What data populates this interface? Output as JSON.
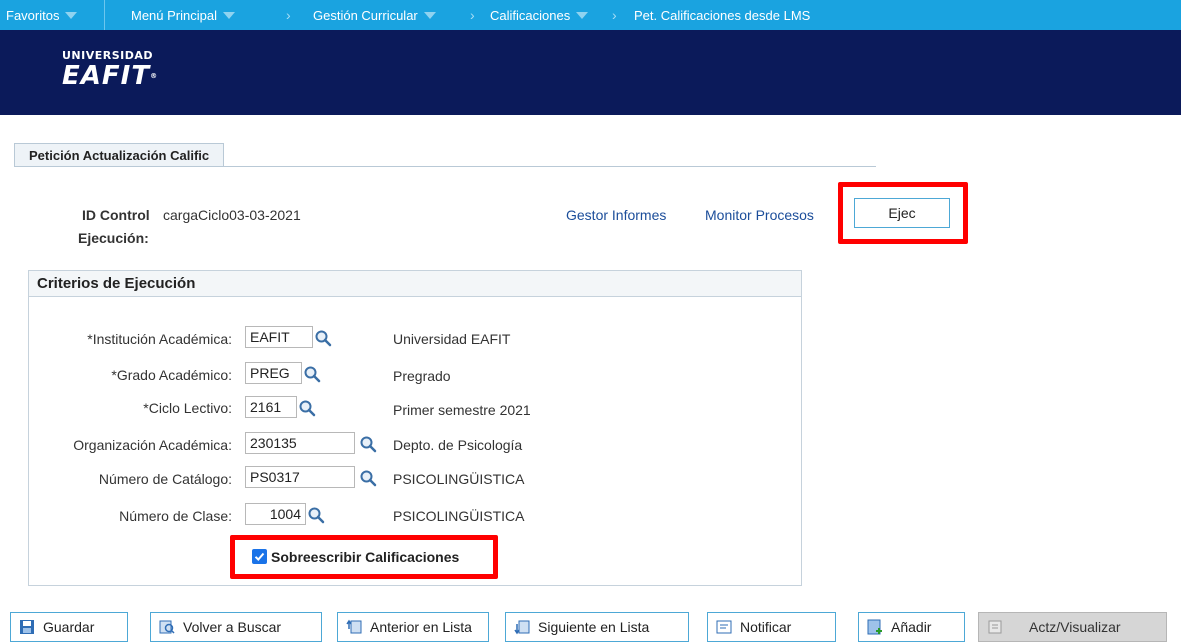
{
  "nav": {
    "favoritos": "Favoritos",
    "menu_principal": "Menú Principal",
    "breadcrumb": [
      "Gestión Curricular",
      "Calificaciones",
      "Pet. Calificaciones desde LMS"
    ]
  },
  "logo": {
    "top": "UNIVERSIDAD",
    "main": "EAFIT"
  },
  "tab": {
    "label": "Petición Actualización Calific"
  },
  "run_control": {
    "label_line1": "ID Control",
    "label_line2": "Ejecución:",
    "value": "cargaCiclo03-03-2021",
    "gestor_link": "Gestor Informes",
    "monitor_link": "Monitor Procesos",
    "run_button": "Ejec"
  },
  "criteria": {
    "title": "Criterios de Ejecución",
    "fields": [
      {
        "label": "*Institución Académica:",
        "value": "EAFIT",
        "description": "Universidad EAFIT"
      },
      {
        "label": "*Grado Académico:",
        "value": "PREG",
        "description": "Pregrado"
      },
      {
        "label": "*Ciclo Lectivo:",
        "value": "2161",
        "description": "Primer semestre 2021"
      },
      {
        "label": "Organización Académica:",
        "value": "230135",
        "description": "Depto. de Psicología"
      },
      {
        "label": "Número de Catálogo:",
        "value": "PS0317",
        "description": "PSICOLINGÜISTICA"
      },
      {
        "label": "Número de Clase:",
        "value": "1004",
        "description": "PSICOLINGÜISTICA"
      }
    ],
    "overwrite_label": "Sobreescribir Calificaciones",
    "overwrite_checked": true
  },
  "toolbar": {
    "guardar": "Guardar",
    "volver_buscar": "Volver a Buscar",
    "anterior": "Anterior en Lista",
    "siguiente": "Siguiente en Lista",
    "notificar": "Notificar",
    "anadir": "Añadir",
    "actualizar": "Actz/Visualizar"
  },
  "colors": {
    "nav_bg": "#1aa3e0",
    "header_bg": "#0b1a5a",
    "highlight": "#ff0000",
    "link": "#1b4d9a"
  }
}
